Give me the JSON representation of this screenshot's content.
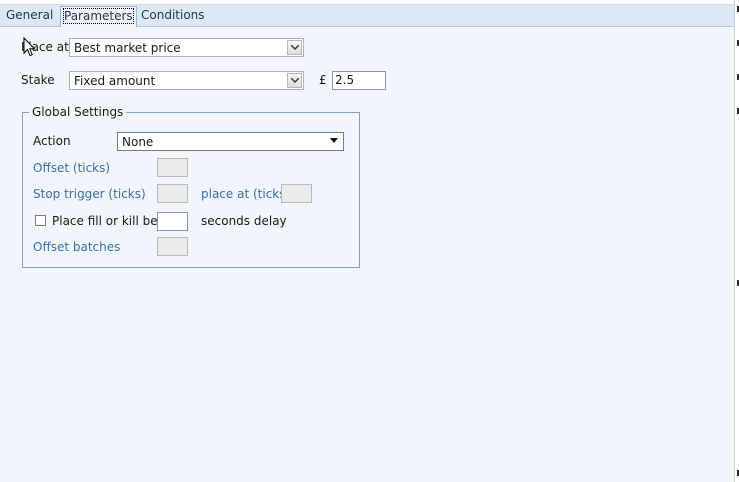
{
  "tabs": [
    {
      "label": "General",
      "active": false
    },
    {
      "label": "Parameters",
      "active": true
    },
    {
      "label": "Conditions",
      "active": false
    }
  ],
  "form": {
    "place_at_label": "Place at",
    "place_at_value": "Best market price",
    "stake_label": "Stake",
    "stake_value": "Fixed amount",
    "currency_symbol": "£",
    "stake_amount": "2.5"
  },
  "global_settings": {
    "title": "Global Settings",
    "action_label": "Action",
    "action_value": "None",
    "offset_ticks_label": "Offset (ticks)",
    "offset_ticks_value": "",
    "stop_trigger_label": "Stop trigger (ticks)",
    "stop_trigger_value": "",
    "place_at_ticks_label": "place at (ticks)",
    "place_at_ticks_value": "",
    "fill_or_kill_label": "Place fill or kill bets",
    "fill_or_kill_checked": false,
    "seconds_delay_value": "",
    "seconds_delay_label": "seconds delay",
    "offset_batches_label": "Offset batches",
    "offset_batches_value": ""
  },
  "colors": {
    "tabbar_bg": "#dbe8f6",
    "panel_bg": "#f0f6fc",
    "muted_label": "#3a6fa8",
    "group_border": "#7fa1c7"
  },
  "icons": {
    "dropdown": "chevron-down-icon",
    "cursor": "mouse-pointer-icon"
  }
}
